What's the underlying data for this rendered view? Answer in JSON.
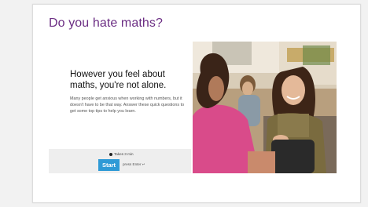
{
  "page": {
    "title": "Do you hate maths?"
  },
  "intro": {
    "headline": "However you feel about maths, you're not alone.",
    "description": "Many people get anxious when working with numbers, but it doesn't have to be that way. Answer these quick questions to get some top tips to help you learn."
  },
  "actions": {
    "duration_label": "Takes 3 min",
    "start_label": "Start",
    "press_hint": "press Enter ↵"
  },
  "colors": {
    "title": "#6b2d83",
    "start_button": "#2f9ad6",
    "start_bar": "#eeeeee"
  },
  "icons": {
    "timer": "clock-icon"
  }
}
